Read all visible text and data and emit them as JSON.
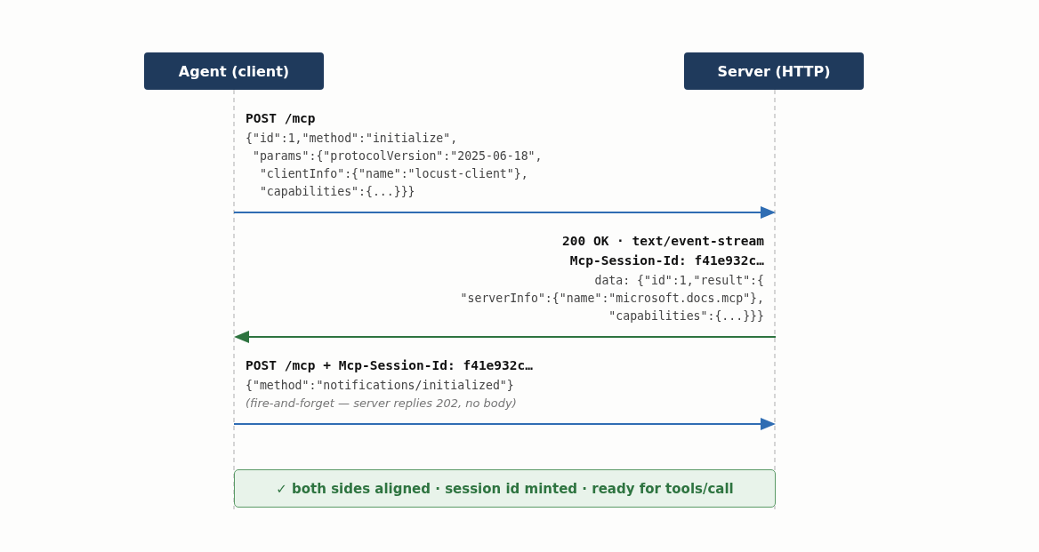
{
  "participants": [
    {
      "label": "Agent (client)"
    },
    {
      "label": "Server (HTTP)"
    }
  ],
  "messages": [
    {
      "kind": "request",
      "color": "#2f6db3",
      "lines": [
        {
          "kind": "head",
          "text": "POST /mcp"
        },
        {
          "kind": "body",
          "text": "{\"id\":1,\"method\":\"initialize\","
        },
        {
          "kind": "body",
          "text": " \"params\":{\"protocolVersion\":\"2025-06-18\","
        },
        {
          "kind": "body",
          "text": "  \"clientInfo\":{\"name\":\"locust-client\"},"
        },
        {
          "kind": "body",
          "text": "  \"capabilities\":{...}}}"
        }
      ]
    },
    {
      "kind": "response",
      "color": "#2e7440",
      "lines": [
        {
          "kind": "head",
          "text": "200 OK · text/event-stream"
        },
        {
          "kind": "head",
          "text": "Mcp-Session-Id: f41e932c…"
        },
        {
          "kind": "body",
          "text": "data: {\"id\":1,\"result\":{"
        },
        {
          "kind": "body",
          "text": "\"serverInfo\":{\"name\":\"microsoft.docs.mcp\"},"
        },
        {
          "kind": "body",
          "text": "\"capabilities\":{...}}}"
        }
      ]
    },
    {
      "kind": "request",
      "color": "#2f6db3",
      "lines": [
        {
          "kind": "head",
          "text": "POST /mcp + Mcp-Session-Id: f41e932c…"
        },
        {
          "kind": "body",
          "text": "{\"method\":\"notifications/initialized\"}"
        },
        {
          "kind": "note",
          "text": "(fire-and-forget — server replies 202, no body)"
        }
      ]
    }
  ],
  "status": {
    "text": "✓ both sides aligned · session id minted · ready for tools/call"
  }
}
